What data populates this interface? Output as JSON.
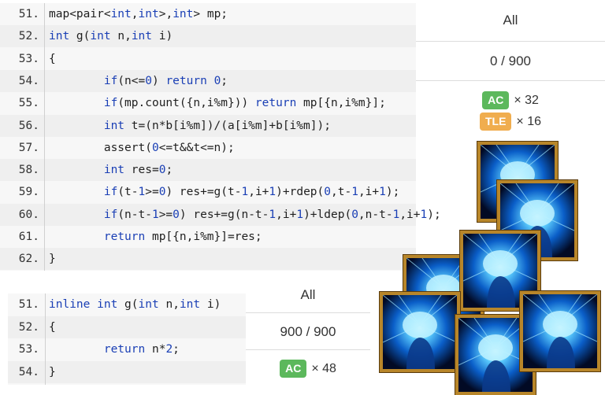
{
  "top_code": {
    "lines": [
      {
        "num": "51.",
        "text": "map<pair<int,int>,int> mp;"
      },
      {
        "num": "52.",
        "text": "int g(int n,int i)"
      },
      {
        "num": "53.",
        "text": "{"
      },
      {
        "num": "54.",
        "text": "        if(n<=0) return 0;"
      },
      {
        "num": "55.",
        "text": "        if(mp.count({n,i%m})) return mp[{n,i%m}];"
      },
      {
        "num": "56.",
        "text": "        int t=(n*b[i%m])/(a[i%m]+b[i%m]);"
      },
      {
        "num": "57.",
        "text": "        assert(0<=t&&t<=n);"
      },
      {
        "num": "58.",
        "text": "        int res=0;"
      },
      {
        "num": "59.",
        "text": "        if(t-1>=0) res+=g(t-1,i+1)+rdep(0,t-1,i+1);"
      },
      {
        "num": "60.",
        "text": "        if(n-t-1>=0) res+=g(n-t-1,i+1)+ldep(0,n-t-1,i+1);"
      },
      {
        "num": "61.",
        "text": "        return mp[{n,i%m}]=res;"
      },
      {
        "num": "62.",
        "text": "}"
      }
    ]
  },
  "bottom_code": {
    "lines": [
      {
        "num": "51.",
        "text": "inline int g(int n,int i)"
      },
      {
        "num": "52.",
        "text": "{"
      },
      {
        "num": "53.",
        "text": "        return n*2;"
      },
      {
        "num": "54.",
        "text": "}"
      }
    ]
  },
  "top_result": {
    "header": "All",
    "score": "0 / 900",
    "verdicts": [
      {
        "badge": "AC",
        "count": "× 32",
        "kind": "ac"
      },
      {
        "badge": "TLE",
        "count": "× 16",
        "kind": "tle"
      }
    ]
  },
  "bottom_result": {
    "header": "All",
    "score": "900 / 900",
    "verdicts": [
      {
        "badge": "AC",
        "count": "× 48",
        "kind": "ac"
      }
    ]
  },
  "colors": {
    "ac": "#5cb85c",
    "tle": "#f0ad4e",
    "keyword": "#1a3fb5",
    "frame": "#b8862a"
  },
  "meme": {
    "image": "glowing-brain-icon",
    "tiles": 7
  }
}
